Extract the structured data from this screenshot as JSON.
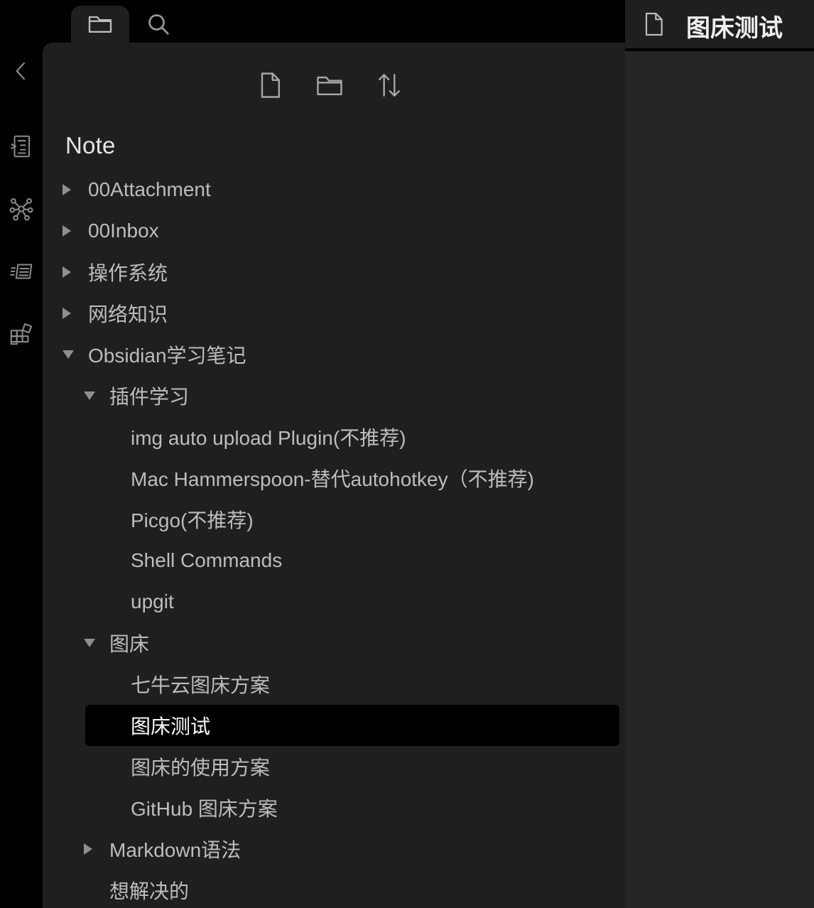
{
  "colors": {
    "background": "#000000",
    "panel": "#1f1f1f",
    "right_pane": "#252525",
    "text": "#bdbdbd",
    "selected_bg": "#000000"
  },
  "header": {
    "tabs": [
      {
        "icon": "folder-icon",
        "active": true
      },
      {
        "icon": "search-icon",
        "active": false
      }
    ]
  },
  "ribbon": {
    "items": [
      {
        "icon": "chevron-left-icon"
      },
      {
        "icon": "command-palette-icon"
      },
      {
        "icon": "graph-view-icon"
      },
      {
        "icon": "slides-icon"
      },
      {
        "icon": "blocks-icon"
      }
    ]
  },
  "toolbar": {
    "buttons": [
      {
        "icon": "new-note-icon"
      },
      {
        "icon": "new-folder-icon"
      },
      {
        "icon": "sort-icon"
      }
    ]
  },
  "vault": {
    "name": "Note"
  },
  "tree": [
    {
      "label": "00Attachment",
      "depth": 0,
      "type": "folder",
      "expanded": false
    },
    {
      "label": "00Inbox",
      "depth": 0,
      "type": "folder",
      "expanded": false
    },
    {
      "label": "操作系统",
      "depth": 0,
      "type": "folder",
      "expanded": false
    },
    {
      "label": "网络知识",
      "depth": 0,
      "type": "folder",
      "expanded": false
    },
    {
      "label": "Obsidian学习笔记",
      "depth": 0,
      "type": "folder",
      "expanded": true
    },
    {
      "label": "插件学习",
      "depth": 1,
      "type": "folder",
      "expanded": true
    },
    {
      "label": "img auto upload Plugin(不推荐)",
      "depth": 2,
      "type": "file"
    },
    {
      "label": "Mac Hammerspoon-替代autohotkey（不推荐)",
      "depth": 2,
      "type": "file"
    },
    {
      "label": "Picgo(不推荐)",
      "depth": 2,
      "type": "file"
    },
    {
      "label": "Shell Commands",
      "depth": 2,
      "type": "file"
    },
    {
      "label": "upgit",
      "depth": 2,
      "type": "file"
    },
    {
      "label": "图床",
      "depth": 1,
      "type": "folder",
      "expanded": true
    },
    {
      "label": "七牛云图床方案",
      "depth": 2,
      "type": "file"
    },
    {
      "label": "图床测试",
      "depth": 2,
      "type": "file",
      "selected": true
    },
    {
      "label": "图床的使用方案",
      "depth": 2,
      "type": "file"
    },
    {
      "label": "GitHub 图床方案",
      "depth": 2,
      "type": "file"
    },
    {
      "label": "Markdown语法",
      "depth": 1,
      "type": "folder",
      "expanded": false
    },
    {
      "label": "想解决的",
      "depth": 1,
      "type": "file"
    }
  ],
  "editor": {
    "tab_title": "图床测试"
  }
}
